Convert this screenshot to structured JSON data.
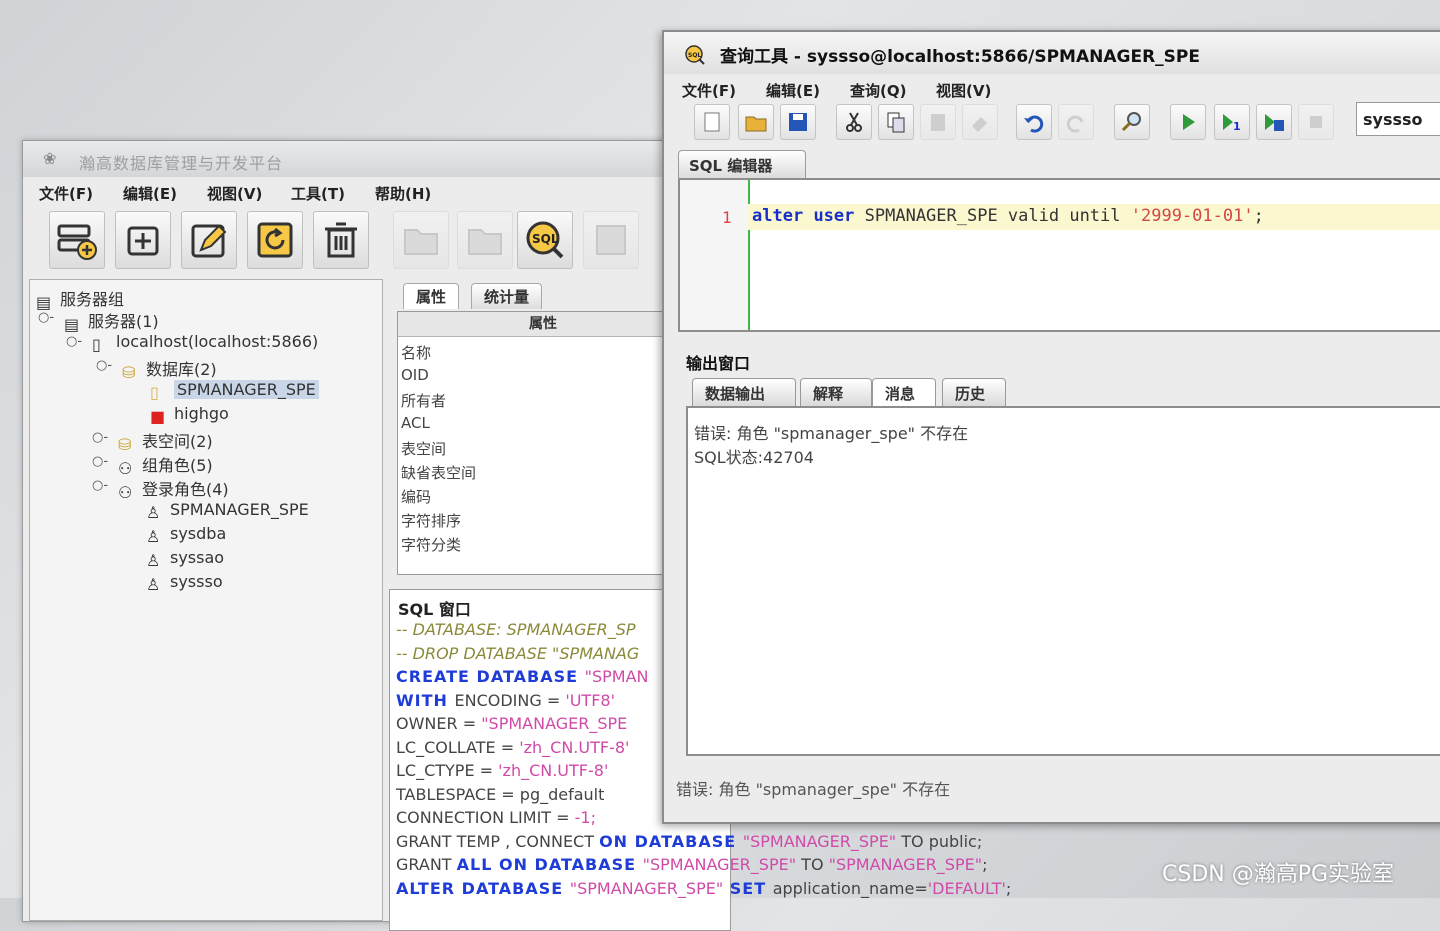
{
  "main_window": {
    "title": "瀚高数据库管理与开发平台",
    "menu": [
      "文件(F)",
      "编辑(E)",
      "视图(V)",
      "工具(T)",
      "帮助(H)"
    ],
    "toolbar_icons": [
      "add-server-icon",
      "add-icon",
      "edit-icon",
      "refresh-icon",
      "delete-icon",
      "folder-icon",
      "folder-icon",
      "sql-query-icon",
      "grid-icon"
    ],
    "tree": {
      "root": "服务器组",
      "servers": "服务器(1)",
      "host": "localhost(localhost:5866)",
      "databases": "数据库(2)",
      "db_items": [
        "SPMANAGER_SPE",
        "highgo"
      ],
      "tablespaces": "表空间(2)",
      "group_roles": "组角色(5)",
      "login_roles": "登录角色(4)",
      "login_items": [
        "SPMANAGER_SPE",
        "sysdba",
        "syssao",
        "syssso"
      ]
    },
    "props": {
      "tabs": [
        "属性",
        "统计量"
      ],
      "header": "属性",
      "rows": [
        "名称",
        "OID",
        "所有者",
        "ACL",
        "表空间",
        "缺省表空间",
        "编码",
        "字符排序",
        "字符分类"
      ]
    },
    "sql_window": {
      "title": "SQL 窗口",
      "lines": [
        {
          "segs": [
            {
              "t": "-- DATABASE: SPMANAGER_SP",
              "c": "com"
            }
          ]
        },
        {
          "segs": [
            {
              "t": "-- DROP DATABASE \"SPMANAG",
              "c": "com"
            }
          ]
        },
        {
          "segs": [
            {
              "t": "CREATE DATABASE ",
              "c": "kw"
            },
            {
              "t": "\"SPMAN",
              "c": "str"
            }
          ]
        },
        {
          "segs": [
            {
              "t": "  WITH ",
              "c": "kw"
            },
            {
              "t": "ENCODING = ",
              "c": "txt"
            },
            {
              "t": "'UTF8'",
              "c": "str"
            }
          ]
        },
        {
          "segs": [
            {
              "t": "   OWNER = ",
              "c": "txt"
            },
            {
              "t": "\"SPMANAGER_SPE",
              "c": "str"
            }
          ]
        },
        {
          "segs": [
            {
              "t": "   LC_COLLATE = ",
              "c": "txt"
            },
            {
              "t": "'zh_CN.UTF-8'",
              "c": "str"
            }
          ]
        },
        {
          "segs": [
            {
              "t": "   LC_CTYPE = ",
              "c": "txt"
            },
            {
              "t": "'zh_CN.UTF-8'",
              "c": "str"
            }
          ]
        },
        {
          "segs": [
            {
              "t": "   TABLESPACE = pg_default",
              "c": "txt"
            }
          ]
        },
        {
          "segs": [
            {
              "t": "   CONNECTION LIMIT = ",
              "c": "txt"
            },
            {
              "t": "-1;",
              "c": "str"
            }
          ]
        },
        {
          "segs": [
            {
              "t": "GRANT TEMP , CONNECT ",
              "c": "txt"
            },
            {
              "t": "ON DATABASE ",
              "c": "kw"
            },
            {
              "t": "\"SPMANAGER_SPE\"",
              "c": "str"
            },
            {
              "t": " TO public;",
              "c": "txt"
            }
          ]
        },
        {
          "segs": [
            {
              "t": "GRANT ",
              "c": "txt"
            },
            {
              "t": "ALL ON DATABASE ",
              "c": "kw"
            },
            {
              "t": "\"SPMANAGER_SPE\"",
              "c": "str"
            },
            {
              "t": " TO ",
              "c": "txt"
            },
            {
              "t": "\"SPMANAGER_SPE\"",
              "c": "str"
            },
            {
              "t": ";",
              "c": "txt"
            }
          ]
        },
        {
          "segs": [
            {
              "t": "ALTER DATABASE ",
              "c": "kw"
            },
            {
              "t": "\"SPMANAGER_SPE\"",
              "c": "str"
            },
            {
              "t": " SET ",
              "c": "kw"
            },
            {
              "t": "application_name=",
              "c": "txt"
            },
            {
              "t": "'DEFAULT'",
              "c": "str"
            },
            {
              "t": ";",
              "c": "txt"
            }
          ]
        }
      ]
    }
  },
  "query_window": {
    "title": "查询工具 - syssso@localhost:5866/SPMANAGER_SPE",
    "menu": [
      "文件(F)",
      "编辑(E)",
      "查询(Q)",
      "视图(V)"
    ],
    "user_combo": "syssso",
    "editor_tab": "SQL 编辑器",
    "line_number": "1",
    "code": {
      "kw1": "alter",
      "kw2": "user",
      "rest": "SPMANAGER_SPE valid until ",
      "str": "'2999-01-01'",
      "end": ";"
    },
    "output_title": "输出窗口",
    "output_tabs": [
      "数据输出",
      "解释",
      "消息",
      "历史"
    ],
    "active_output_tab": "消息",
    "messages": [
      "错误: 角色 \"spmanager_spe\" 不存在",
      "SQL状态:42704"
    ],
    "status_bar": "错误: 角色 \"spmanager_spe\" 不存在"
  },
  "watermark": "CSDN @瀚高PG实验室"
}
